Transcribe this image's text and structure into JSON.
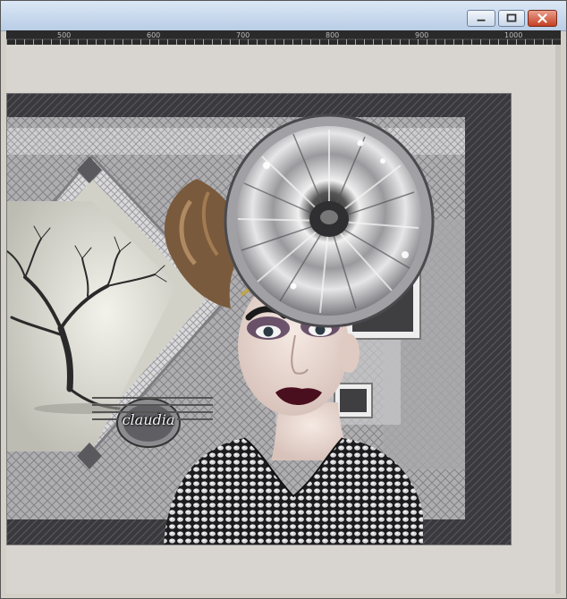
{
  "window": {
    "buttons": {
      "minimize": "minimize",
      "maximize": "maximize",
      "close": "close"
    }
  },
  "ruler": {
    "labels": [
      "500",
      "600",
      "700",
      "800",
      "900",
      "1000"
    ]
  },
  "artwork": {
    "signature": "claudia",
    "icons": {
      "tree": "bare-tree-illustration",
      "woman": "woman-with-silver-hat",
      "hat": "silver-flower-hat"
    }
  }
}
